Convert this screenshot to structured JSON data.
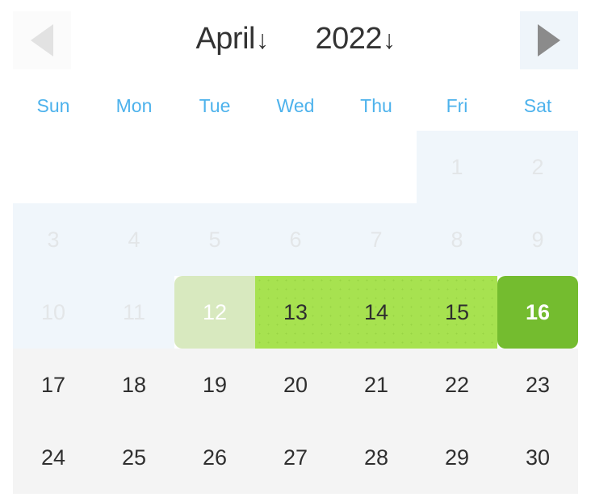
{
  "header": {
    "prev_button": {
      "icon": "triangle-left-icon",
      "label": "Previous month",
      "enabled": false
    },
    "next_button": {
      "icon": "triangle-right-icon",
      "label": "Next month",
      "enabled": true
    },
    "month": "April",
    "month_caret": "↓",
    "year": "2022",
    "year_caret": "↓"
  },
  "weekdays": [
    "Sun",
    "Mon",
    "Tue",
    "Wed",
    "Thu",
    "Fri",
    "Sat"
  ],
  "colors": {
    "weekday_text": "#4db2ec",
    "disabled_bg": "#f0f6fb",
    "disabled_text": "#e3e6e8",
    "enabled_bg": "#f4f4f4",
    "enabled_text": "#2f2f2f",
    "range_start_bg": "#d8e9bf",
    "range_mid_bg": "#a7e250",
    "selected_bg": "#74bc2f",
    "selected_text": "#ffffff",
    "next_arrow": "#8b8b8b",
    "prev_arrow": "#e2e2e2",
    "title_text": "#333333"
  },
  "weeks": [
    [
      {
        "label": "",
        "state": "empty"
      },
      {
        "label": "",
        "state": "empty"
      },
      {
        "label": "",
        "state": "empty"
      },
      {
        "label": "",
        "state": "empty"
      },
      {
        "label": "",
        "state": "empty"
      },
      {
        "label": "1",
        "state": "disabled"
      },
      {
        "label": "2",
        "state": "disabled"
      }
    ],
    [
      {
        "label": "3",
        "state": "disabled"
      },
      {
        "label": "4",
        "state": "disabled"
      },
      {
        "label": "5",
        "state": "disabled"
      },
      {
        "label": "6",
        "state": "disabled"
      },
      {
        "label": "7",
        "state": "disabled"
      },
      {
        "label": "8",
        "state": "disabled"
      },
      {
        "label": "9",
        "state": "disabled"
      }
    ],
    [
      {
        "label": "10",
        "state": "disabled"
      },
      {
        "label": "11",
        "state": "disabled"
      },
      {
        "label": "12",
        "state": "range-start"
      },
      {
        "label": "13",
        "state": "range-mid"
      },
      {
        "label": "14",
        "state": "range-mid"
      },
      {
        "label": "15",
        "state": "range-mid"
      },
      {
        "label": "16",
        "state": "selected"
      }
    ],
    [
      {
        "label": "17",
        "state": "enabled"
      },
      {
        "label": "18",
        "state": "enabled"
      },
      {
        "label": "19",
        "state": "enabled"
      },
      {
        "label": "20",
        "state": "enabled"
      },
      {
        "label": "21",
        "state": "enabled"
      },
      {
        "label": "22",
        "state": "enabled"
      },
      {
        "label": "23",
        "state": "enabled"
      }
    ],
    [
      {
        "label": "24",
        "state": "enabled"
      },
      {
        "label": "25",
        "state": "enabled"
      },
      {
        "label": "26",
        "state": "enabled"
      },
      {
        "label": "27",
        "state": "enabled"
      },
      {
        "label": "28",
        "state": "enabled"
      },
      {
        "label": "29",
        "state": "enabled"
      },
      {
        "label": "30",
        "state": "enabled"
      }
    ]
  ]
}
